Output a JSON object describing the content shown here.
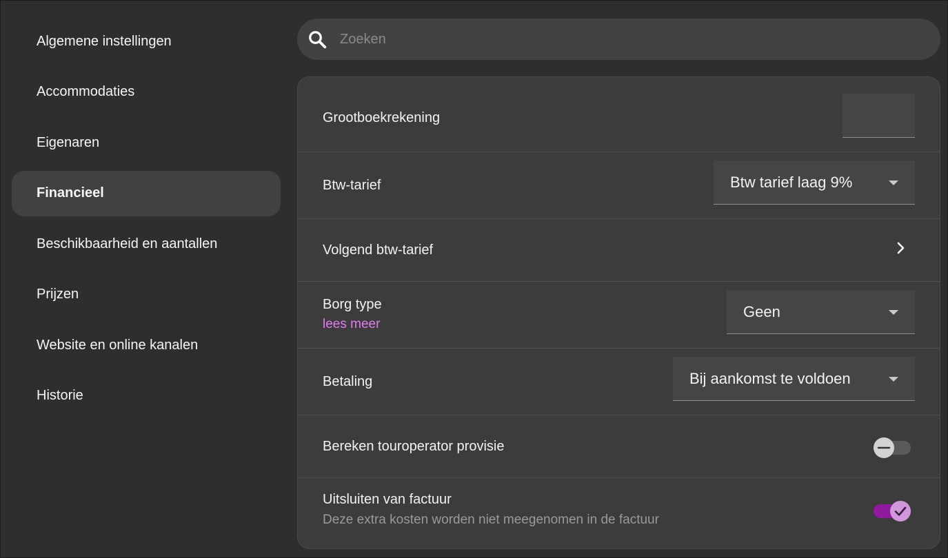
{
  "sidebar": {
    "items": [
      {
        "label": "Algemene instellingen"
      },
      {
        "label": "Accommodaties"
      },
      {
        "label": "Eigenaren"
      },
      {
        "label": "Financieel"
      },
      {
        "label": "Beschikbaarheid en aantallen"
      },
      {
        "label": "Prijzen"
      },
      {
        "label": "Website en online kanalen"
      },
      {
        "label": "Historie"
      }
    ],
    "active": "Financieel"
  },
  "search": {
    "placeholder": "Zoeken",
    "icon": "search-icon"
  },
  "settings": {
    "grootboekrekening": {
      "label": "Grootboekrekening",
      "value": ""
    },
    "btw_tarief": {
      "label": "Btw-tarief",
      "value": "Btw tarief laag 9%"
    },
    "volgend_btw_tarief": {
      "label": "Volgend btw-tarief",
      "icon": "chevron-right-icon"
    },
    "borg_type": {
      "label": "Borg type",
      "link": "lees meer",
      "value": "Geen"
    },
    "betaling": {
      "label": "Betaling",
      "value": "Bij aankomst te voldoen"
    },
    "touroperator_provisie": {
      "label": "Bereken touroperator provisie",
      "enabled": false
    },
    "uitsluiten_factuur": {
      "label": "Uitsluiten van factuur",
      "description": "Deze extra kosten worden niet meegenomen in de factuur",
      "enabled": true
    }
  },
  "colors": {
    "background": "#2e2e2e",
    "card": "#3c3c3c",
    "accent": "#8f1aa0",
    "accent_light": "#d196dc",
    "link": "#e27bf0"
  }
}
